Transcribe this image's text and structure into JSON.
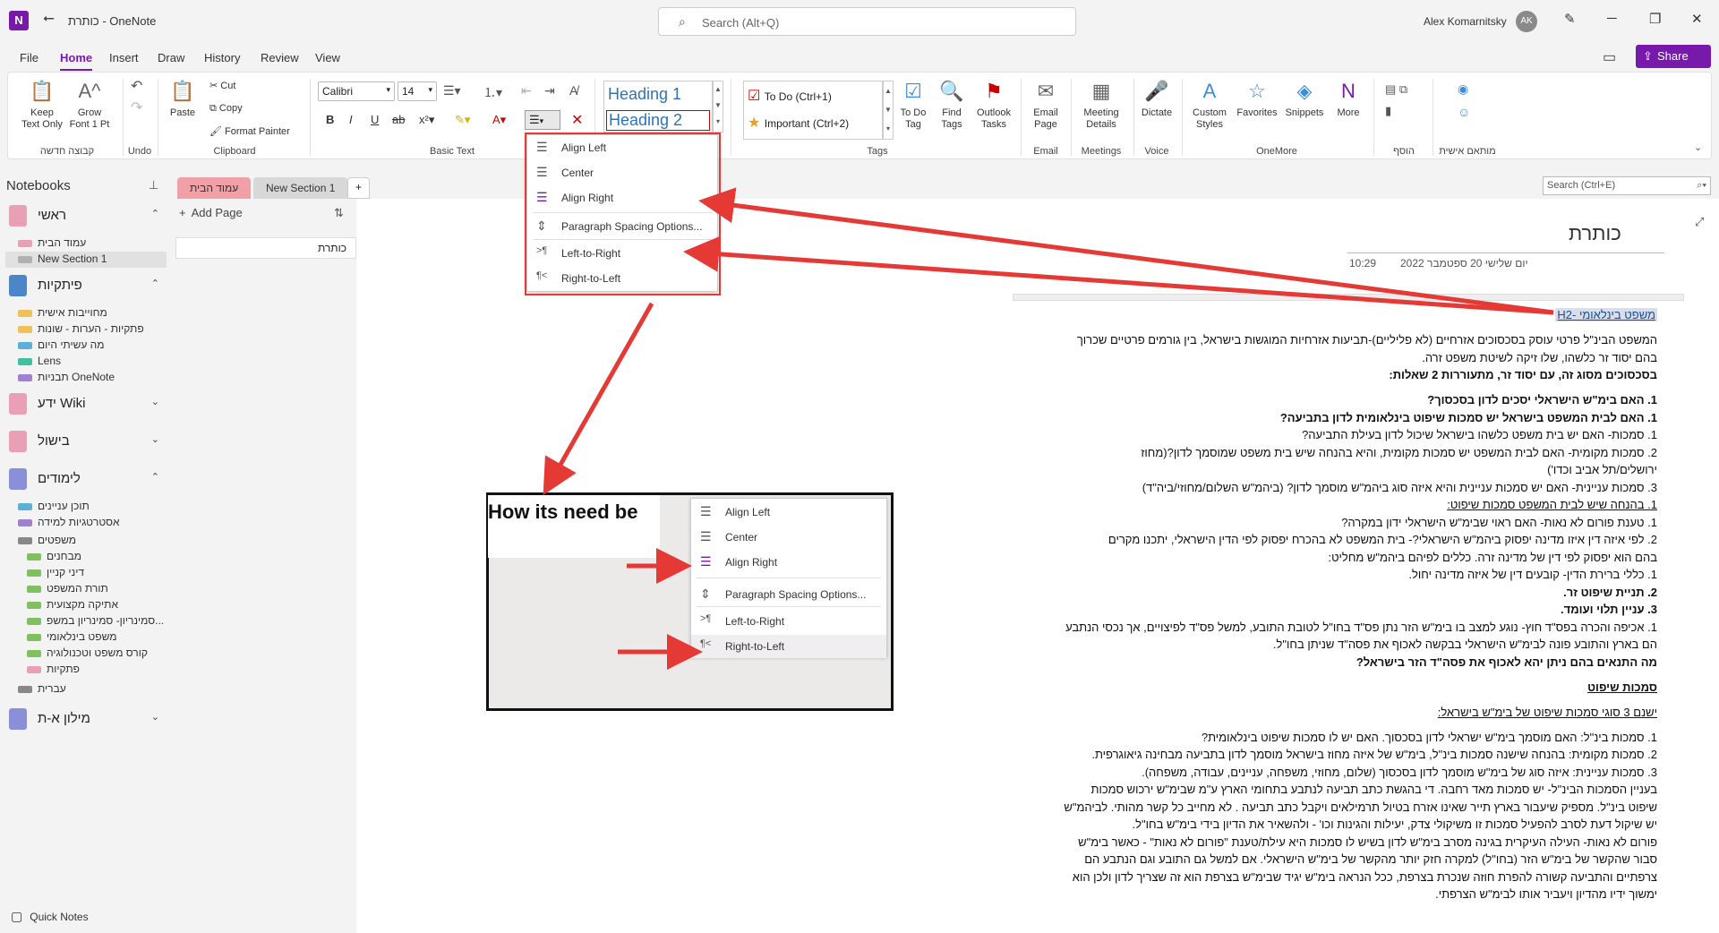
{
  "titlebar": {
    "logo": "N",
    "back": "⭠",
    "title": "כותרת  -  OneNote",
    "search_placeholder": "Search (Alt+Q)",
    "user": "Alex Komarnitsky",
    "avatar": "AK",
    "min": "─",
    "restore": "❐",
    "close": "✕"
  },
  "menu": {
    "file": "File",
    "home": "Home",
    "insert": "Insert",
    "draw": "Draw",
    "history": "History",
    "review": "Review",
    "view": "View",
    "share": "Share"
  },
  "ribbon": {
    "keep_text": "Keep\nText Only",
    "grow_font": "Grow\nFont 1 Pt",
    "group_hebrew": "קבוצה חדשה",
    "undo": "Undo",
    "paste": "Paste",
    "cut": "Cut",
    "copy": "Copy",
    "format_painter": "Format Painter",
    "clipboard": "Clipboard",
    "font": "Calibri",
    "size": "14",
    "basic_text": "Basic Text",
    "heading1": "Heading 1",
    "heading2": "Heading 2",
    "styles": "Styles",
    "todo": "To Do (Ctrl+1)",
    "important": "Important (Ctrl+2)",
    "tags": "Tags",
    "todo_tag": "To Do\nTag",
    "find_tags": "Find\nTags",
    "outlook": "Outlook\nTasks",
    "email_page": "Email\nPage",
    "email": "Email",
    "meeting_details": "Meeting\nDetails",
    "meetings": "Meetings",
    "dictate": "Dictate",
    "voice": "Voice",
    "custom_styles": "Custom\nStyles",
    "favorites": "Favorites",
    "snippets": "Snippets",
    "more": "More",
    "onemore": "OneMore",
    "add_group": "הוסף",
    "personal": "מותאם אישית"
  },
  "notebooks": {
    "header": "Notebooks",
    "items": [
      {
        "name": "ראשי",
        "color": "#e9a0b4",
        "sections": [
          {
            "name": "עמוד הבית",
            "color": "#e9a0b4"
          },
          {
            "name": "New Section 1",
            "color": "#b0b0b0"
          }
        ]
      },
      {
        "name": "פיתקיות",
        "color": "#4a86c8",
        "sections": [
          {
            "name": "מחוייבות אישית",
            "color": "#f0c05a"
          },
          {
            "name": "פתקיות - הערות - שונות",
            "color": "#f0c05a"
          },
          {
            "name": "מה עשיתי היום",
            "color": "#5ab0d8"
          },
          {
            "name": "Lens",
            "color": "#40c0a0"
          },
          {
            "name": "תבניות OneNote",
            "color": "#a080d0"
          }
        ]
      },
      {
        "name": "ידע Wiki",
        "color": "#e9a0b4",
        "sections": []
      },
      {
        "name": "בישול",
        "color": "#e9a0b4",
        "sections": []
      },
      {
        "name": "לימודים",
        "color": "#8a90d8",
        "sections": [
          {
            "name": "תוכן עניינים",
            "color": "#5ab0d8"
          },
          {
            "name": "אסטרטגיות למידה",
            "color": "#a080d0"
          },
          {
            "name": "משפטים",
            "color": "#888888"
          },
          {
            "name": "מבחנים",
            "color": "#80c060"
          },
          {
            "name": "דיני קניין",
            "color": "#80c060"
          },
          {
            "name": "תורת המשפט",
            "color": "#80c060"
          },
          {
            "name": "אתיקה מקצועית",
            "color": "#80c060"
          },
          {
            "name": "סמינריון- סמינריון במשפ...",
            "color": "#80c060"
          },
          {
            "name": "משפט בינלאומי",
            "color": "#80c060"
          },
          {
            "name": "קורס משפט וטכנולוגיה",
            "color": "#80c060"
          },
          {
            "name": "פתקיות",
            "color": "#e9a0b4"
          },
          {
            "name": "עברית",
            "color": "#888888"
          }
        ]
      },
      {
        "name": "מילון א-ת",
        "color": "#8a90d8",
        "sections": []
      }
    ],
    "quick_notes": "Quick Notes"
  },
  "tabs": {
    "home": "עמוד הבית",
    "new_section": "New Section 1",
    "add": "+",
    "search": "Search (Ctrl+E)"
  },
  "pages": {
    "add_page": "Add Page",
    "item": "כותרת"
  },
  "page": {
    "title": "כותרת",
    "date": "יום שלישי 20 ספטמבר 2022",
    "time": "10:29",
    "lines": [
      {
        "t": "משפט בינלאומי -H2",
        "cls": "u"
      },
      {
        "t": "המשפט הבינ\"ל פרטי עוסק בסכסוכים אזרחיים (לא פליליים)-תביעות אזרחיות המוגשות בישראל, בין גורמים פרטיים שכרוך",
        "cls": ""
      },
      {
        "t": "בהם יסוד זר כלשהו, שלו זיקה לשיטת משפט זרה.",
        "cls": ""
      },
      {
        "t": "בסכסוכים מסוג זה, עם יסוד זר, מתעוררות 2 שאלות:",
        "cls": "b"
      },
      {
        "t": "1. האם בימ\"ש הישראלי יסכים לדון בסכסוך?",
        "cls": "b"
      },
      {
        "t": "1. האם לבית המשפט בישראל יש סמכות שיפוט בינלאומית לדון בתביעה?",
        "cls": "b"
      },
      {
        "t": "1. סמכות- האם יש בית משפט כלשהו בישראל שיכול לדון בעילת התביעה?",
        "cls": ""
      },
      {
        "t": "2. סמכות מקומית- האם לבית המשפט יש סמכות מקומית, והיא בהנחה שיש בית משפט שמוסמך לדון?(מחוז",
        "cls": ""
      },
      {
        "t": "ירושלים/תל אביב וכדו')",
        "cls": ""
      },
      {
        "t": "3. סמכות עניינית- האם יש סמכות עניינית והיא איזה סוג ביהמ\"ש מוסמך לדון? (ביהמ\"ש השלום/מחוזי/ביה\"ד)",
        "cls": ""
      },
      {
        "t": "1. בהנחה שיש לבית המשפט סמכות שיפוט:",
        "cls": "u"
      },
      {
        "t": "1. טענת פורום לא נאות- האם ראוי שבימ\"ש הישראלי ידון במקרה?",
        "cls": ""
      },
      {
        "t": "2. לפי איזה דין איזו מדינה יפסוק ביהמ\"ש הישראלי?- בית המשפט לא בהכרח יפסוק לפי הדין הישראלי, יתכנו מקרים",
        "cls": ""
      },
      {
        "t": "בהם הוא יפסוק לפי דין של מדינה זרה. כללים לפיהם ביהמ\"ש מחליט:",
        "cls": ""
      },
      {
        "t": "1. כללי ברירת הדין- קובעים דין של איזה מדינה יחול.",
        "cls": ""
      },
      {
        "t": "2. תניית שיפוט זר.",
        "cls": "b"
      },
      {
        "t": "3. עניין תלוי ועומד.",
        "cls": "b"
      },
      {
        "t": "1. אכיפה והכרה בפס\"ד חוץ- נוגע למצב בו בימ\"ש הזר נתן פס\"ד בחו\"ל לטובת התובע, למשל פס\"ד לפיצויים, אך נכסי הנתבע",
        "cls": ""
      },
      {
        "t": "הם בארץ והתובע פונה לבימ\"ש הישראלי בבקשה לאכוף את פסה\"ד שניתן בחו\"ל.",
        "cls": ""
      },
      {
        "t": "מה התנאים בהם ניתן יהא לאכוף את פסה\"ד הזר בישראל?",
        "cls": "b"
      },
      {
        "t": "סמכות שיפוט",
        "cls": "b u"
      },
      {
        "t": "ישנם 3 סוגי סמכות שיפוט של בימ\"ש בישראל:",
        "cls": "u"
      },
      {
        "t": "1. סמכות בינ\"ל: האם מוסמך בימ\"ש ישראלי לדון בסכסוך. האם יש לו סמכות שיפוט בינלאומית?",
        "cls": ""
      },
      {
        "t": "2. סמכות מקומית: בהנחה שישנה סמכות בינ\"ל, בימ\"ש של איזה מחוז בישראל מוסמך לדון בתביעה מבחינה גיאוגרפית.",
        "cls": ""
      },
      {
        "t": "3. סמכות עניינית: איזה סוג של בימ\"ש מוסמך לדון בסכסוך (שלום, מחוזי, משפחה, עניינים, עבודה, משפחה).",
        "cls": ""
      },
      {
        "t": "בעניין הסמכות הבינ\"ל- יש סמכות מאד רחבה. די בהגשת כתב תביעה לנתבע בתחומי הארץ ע\"מ שבימ\"ש ירכוש סמכות",
        "cls": ""
      },
      {
        "t": "שיפוט בינ\"ל. מספיק שיעבור בארץ תייר שאינו אזרח בטיול תרמילאים ויקבל כתב תביעה . לא מחייב כל קשר מהותי. לביהמ\"ש",
        "cls": ""
      },
      {
        "t": "יש שיקול דעת לסרב להפעיל סמכות זו משיקולי צדק, יעילות והגינות וכו' - ולהשאיר את הדיון בידי בימ\"ש בחו\"ל.",
        "cls": ""
      },
      {
        "t": "פורום לא נאות- העילה העיקרית בגינה מסרב בימ\"ש לדון בשיש לו סמכות היא עילת/טענת \"פורום לא נאות\" - כאשר בימ\"ש",
        "cls": ""
      },
      {
        "t": "סבור שהקשר של בימ\"ש הזר (בחו\"ל) למקרה חזק יותר מהקשר של בימ\"ש הישראלי. אם למשל גם התובע וגם הנתבע הם",
        "cls": ""
      },
      {
        "t": "צרפתיים והתביעה קשורה להפרת חוזה שנכרת בצרפת, ככל הנראה בימ\"ש יגיד שבימ\"ש בצרפת הוא זה שצריך לדון ולכן הוא",
        "cls": ""
      },
      {
        "t": "ימשוך ידיו מהדיון ויעביר אותו לבימ\"ש הצרפתי.",
        "cls": ""
      }
    ]
  },
  "dropdown": {
    "align_left": "Align Left",
    "center": "Center",
    "align_right": "Align Right",
    "paragraph_spacing": "Paragraph Spacing Options...",
    "ltr": "Left-to-Right",
    "rtl": "Right-to-Left"
  },
  "example": {
    "title": "How its need be"
  },
  "colors": {
    "accent": "#7719aa",
    "arrow": "#e53935"
  }
}
